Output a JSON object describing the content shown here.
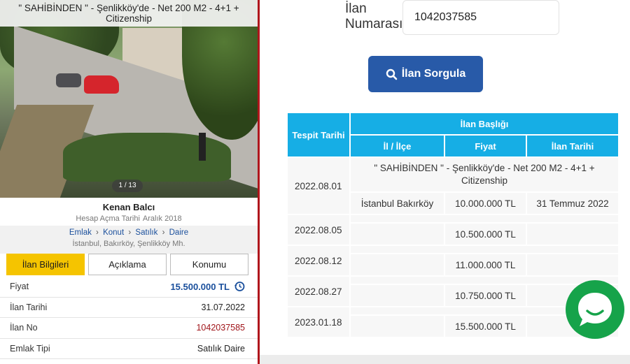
{
  "listing": {
    "title": "\" SAHİBİNDEN \" - Şenlikköy'de - Net 200 M2 - 4+1 + Citizenship",
    "photo_counter": "1 / 13",
    "seller_name": "Kenan Balcı",
    "account_label": "Hesap Açma Tarihi",
    "account_date": "Aralık 2018",
    "breadcrumbs": [
      "Emlak",
      "Konut",
      "Satılık",
      "Daire"
    ],
    "crumb_sep": "›",
    "location": [
      "İstanbul,",
      "Bakırköy,",
      "Şenlikköy Mh."
    ],
    "tabs": [
      "İlan Bilgileri",
      "Açıklama",
      "Konumu"
    ],
    "active_tab": 0,
    "details": [
      {
        "label": "Fiyat",
        "value": "15.500.000 TL"
      },
      {
        "label": "İlan Tarihi",
        "value": "31.07.2022"
      },
      {
        "label": "İlan No",
        "value": "1042037585"
      },
      {
        "label": "Emlak Tipi",
        "value": "Satılık Daire"
      }
    ]
  },
  "query": {
    "label_line1": "İlan",
    "label_line2": "Numarası",
    "input_value": "1042037585",
    "button_label": "İlan Sorgula"
  },
  "results": {
    "headers": {
      "tespit_tarihi": "Tespit Tarihi",
      "ilan_basligi": "İlan Başlığı",
      "il_ilce": "İl / İlçe",
      "fiyat": "Fiyat",
      "ilan_tarihi": "İlan Tarihi"
    },
    "first_row": {
      "date": "2022.08.01",
      "title": "\" SAHİBİNDEN \" - Şenlikköy'de - Net 200 M2 - 4+1 + Citizenship",
      "il_ilce": "İstanbul Bakırköy",
      "fiyat": "10.000.000 TL",
      "ilan_tarihi": "31 Temmuz 2022"
    },
    "rows": [
      {
        "date": "2022.08.05",
        "fiyat": "10.500.000 TL"
      },
      {
        "date": "2022.08.12",
        "fiyat": "11.000.000 TL"
      },
      {
        "date": "2022.08.27",
        "fiyat": "10.750.000 TL"
      },
      {
        "date": "2023.01.18",
        "fiyat": "15.500.000 TL"
      }
    ]
  },
  "colors": {
    "table_header": "#16aee5",
    "button": "#285aa8",
    "active_tab": "#f5c400",
    "divider": "#b0161c",
    "chat": "#16a34a"
  }
}
